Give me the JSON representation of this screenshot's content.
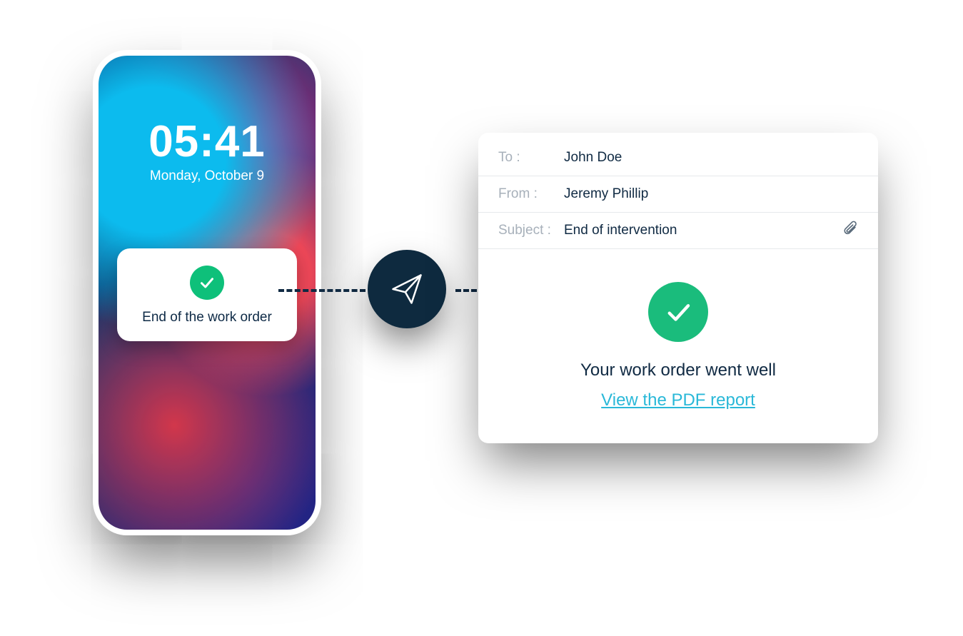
{
  "phone": {
    "time": "05:41",
    "date": "Monday, October 9",
    "notification": {
      "icon": "check-icon",
      "text": "End of the work order"
    }
  },
  "connector": {
    "icon": "paper-plane-icon"
  },
  "email": {
    "to_label": "To :",
    "to_value": "John Doe",
    "from_label": "From :",
    "from_value": "Jeremy Phillip",
    "subject_label": "Subject :",
    "subject_value": "End of intervention",
    "attachment_icon": "paperclip-icon",
    "body": {
      "icon": "check-icon",
      "message": "Your work order went well",
      "link_text": "View the PDF report"
    }
  },
  "colors": {
    "accent_green": "#1abc7c",
    "dark_navy": "#102a43",
    "link_cyan": "#29b8d8",
    "badge_navy": "#0e2a3f"
  }
}
